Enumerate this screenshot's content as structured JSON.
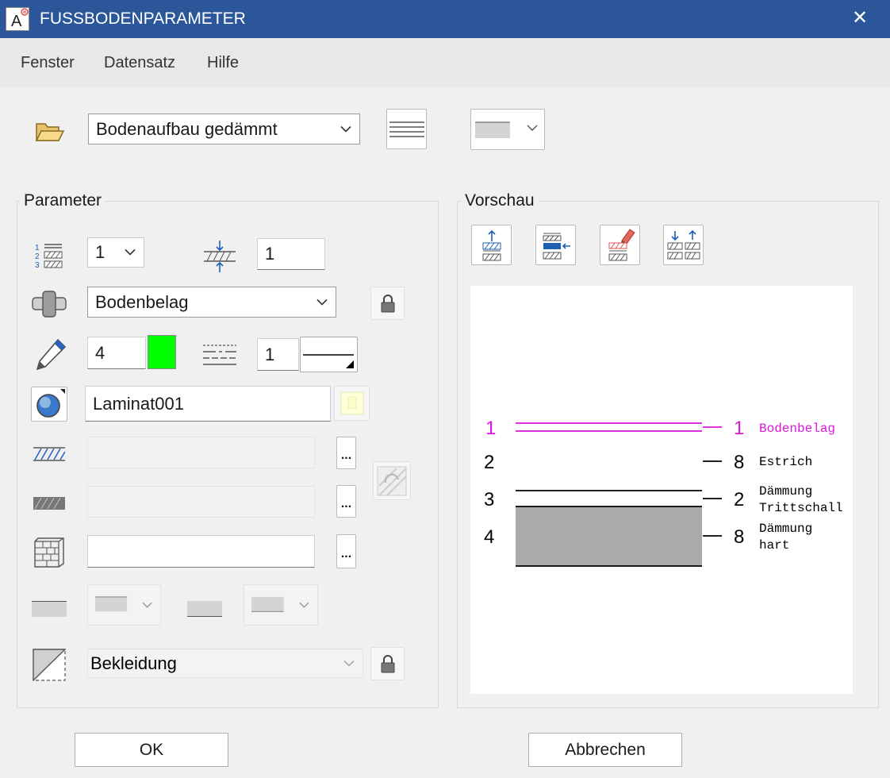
{
  "window": {
    "title": "FUSSBODENPARAMETER",
    "close_symbol": "✕"
  },
  "menu": [
    "Fenster",
    "Datensatz",
    "Hilfe"
  ],
  "top": {
    "preset": "Bodenaufbau gedämmt"
  },
  "parameter": {
    "label": "Parameter",
    "number_select": "1",
    "offset_value": "1",
    "layer_type": "Bodenbelag",
    "pen_value": "4",
    "pen_color": "#00ff00",
    "line_value": "1",
    "material": "Laminat001",
    "cladding": "Bekleidung"
  },
  "preview": {
    "label": "Vorschau",
    "highlight_color": "#d916d9",
    "left_numbers": [
      "1",
      "2",
      "3",
      "4"
    ],
    "right_numbers": [
      "1",
      "8",
      "2",
      "8"
    ],
    "layer_names": [
      [
        "Bodenbelag"
      ],
      [
        "Estrich"
      ],
      [
        "Dämmung",
        "Trittschall"
      ],
      [
        "Dämmung",
        "hart"
      ]
    ]
  },
  "buttons": {
    "ok": "OK",
    "cancel": "Abbrechen"
  }
}
